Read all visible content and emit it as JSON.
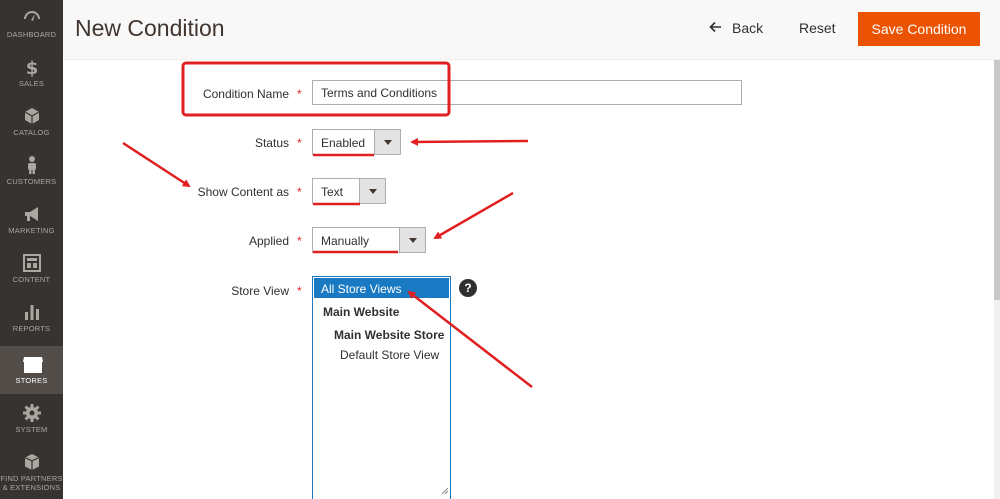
{
  "sidebar": {
    "items": [
      {
        "label": "DASHBOARD",
        "icon": "dashboard-icon"
      },
      {
        "label": "SALES",
        "icon": "dollar-icon"
      },
      {
        "label": "CATALOG",
        "icon": "cube-icon"
      },
      {
        "label": "CUSTOMERS",
        "icon": "person-icon"
      },
      {
        "label": "MARKETING",
        "icon": "megaphone-icon"
      },
      {
        "label": "CONTENT",
        "icon": "layout-icon"
      },
      {
        "label": "REPORTS",
        "icon": "bar-chart-icon"
      },
      {
        "label": "STORES",
        "icon": "storefront-icon"
      },
      {
        "label": "SYSTEM",
        "icon": "gear-icon"
      },
      {
        "label": "FIND PARTNERS",
        "label2": "& EXTENSIONS",
        "icon": "box-icon"
      }
    ],
    "active": "STORES"
  },
  "header": {
    "title": "New Condition",
    "back_label": "Back",
    "reset_label": "Reset",
    "save_label": "Save Condition"
  },
  "form": {
    "condition_name": {
      "label": "Condition Name",
      "value": "Terms and Conditions"
    },
    "status": {
      "label": "Status",
      "value": "Enabled"
    },
    "show_content_as": {
      "label": "Show Content as",
      "value": "Text"
    },
    "applied": {
      "label": "Applied",
      "value": "Manually"
    },
    "store_view": {
      "label": "Store View",
      "options": [
        "All Store Views",
        "Main Website",
        "Main Website Store",
        "Default Store View"
      ],
      "selected": "All Store Views",
      "help": "?"
    },
    "required_mark": "*"
  },
  "colors": {
    "accent": "#eb5202",
    "sidebar_bg": "#373330",
    "selection": "#1979c3",
    "annotation": "#e02020"
  }
}
